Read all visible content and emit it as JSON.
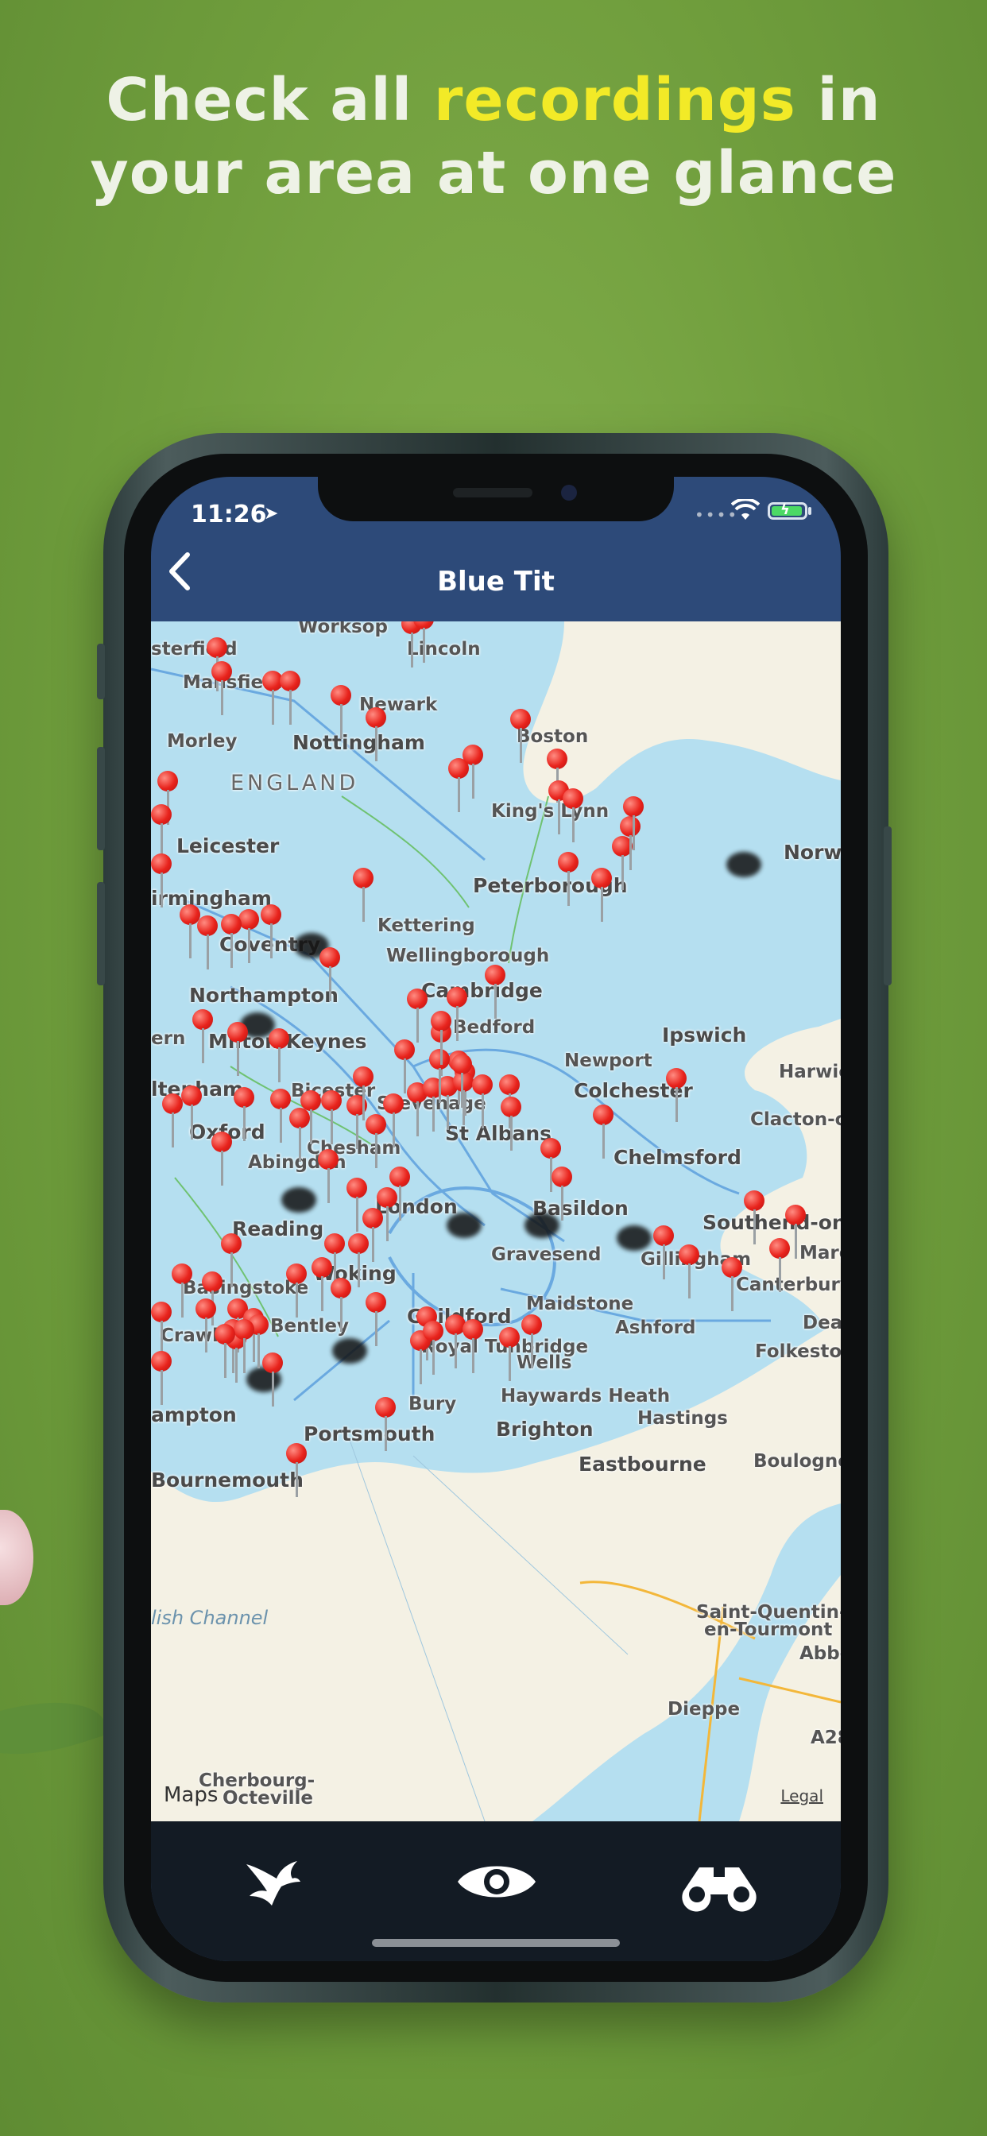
{
  "headline": {
    "line1_before": "Check all ",
    "line1_highlight": "recordings",
    "line1_after": " in",
    "line2": "your area at one glance"
  },
  "status_bar": {
    "time": "11:26"
  },
  "nav": {
    "title": "Blue Tit"
  },
  "map": {
    "places": [
      {
        "name": "Worksop",
        "cls": "place"
      },
      {
        "name": "Lincoln",
        "cls": "place"
      },
      {
        "name": "sterfield",
        "cls": "place"
      },
      {
        "name": "Mansfield",
        "cls": "place"
      },
      {
        "name": "Newark",
        "cls": "place"
      },
      {
        "name": "Boston",
        "cls": "place"
      },
      {
        "name": "Morley",
        "cls": "place"
      },
      {
        "name": "Nottingham",
        "cls": "place big"
      },
      {
        "name": "ENGLAND",
        "cls": "place region"
      },
      {
        "name": "King's Lynn",
        "cls": "place"
      },
      {
        "name": "Norwi",
        "cls": "place big"
      },
      {
        "name": "Leicester",
        "cls": "place big"
      },
      {
        "name": "Peterborough",
        "cls": "place big"
      },
      {
        "name": "irmingham",
        "cls": "place big"
      },
      {
        "name": "Kettering",
        "cls": "place"
      },
      {
        "name": "Coventry",
        "cls": "place big"
      },
      {
        "name": "Wellingborough",
        "cls": "place"
      },
      {
        "name": "Cambridge",
        "cls": "place big"
      },
      {
        "name": "Northampton",
        "cls": "place big"
      },
      {
        "name": "Bedford",
        "cls": "place"
      },
      {
        "name": "ern",
        "cls": "place"
      },
      {
        "name": "Milton Keynes",
        "cls": "place big"
      },
      {
        "name": "Ipswich",
        "cls": "place big"
      },
      {
        "name": "Newport",
        "cls": "place"
      },
      {
        "name": "Harwic",
        "cls": "place"
      },
      {
        "name": "ltenham",
        "cls": "place big"
      },
      {
        "name": "Bicester",
        "cls": "place"
      },
      {
        "name": "Stevenage",
        "cls": "place"
      },
      {
        "name": "Colchester",
        "cls": "place big"
      },
      {
        "name": "Clacton-on-",
        "cls": "place"
      },
      {
        "name": "Oxford",
        "cls": "place big"
      },
      {
        "name": "St Albans",
        "cls": "place big"
      },
      {
        "name": "Chelmsford",
        "cls": "place big"
      },
      {
        "name": "Abingdon",
        "cls": "place"
      },
      {
        "name": "Chesham",
        "cls": "place"
      },
      {
        "name": "London",
        "cls": "place big"
      },
      {
        "name": "Basildon",
        "cls": "place big"
      },
      {
        "name": "Southend-on-Se",
        "cls": "place big"
      },
      {
        "name": "Reading",
        "cls": "place big"
      },
      {
        "name": "Gravesend",
        "cls": "place"
      },
      {
        "name": "Gillingham",
        "cls": "place"
      },
      {
        "name": "Marg",
        "cls": "place"
      },
      {
        "name": "Basingstoke",
        "cls": "place"
      },
      {
        "name": "Woking",
        "cls": "place big"
      },
      {
        "name": "Canterbury",
        "cls": "place"
      },
      {
        "name": "Maidstone",
        "cls": "place"
      },
      {
        "name": "Bentley",
        "cls": "place"
      },
      {
        "name": "Guildford",
        "cls": "place big"
      },
      {
        "name": "Ashford",
        "cls": "place"
      },
      {
        "name": "Deal",
        "cls": "place"
      },
      {
        "name": "Crawl",
        "cls": "place"
      },
      {
        "name": "Royal Tunbridge",
        "cls": "place"
      },
      {
        "name": "Wells",
        "cls": "place"
      },
      {
        "name": "Folkestone",
        "cls": "place"
      },
      {
        "name": "Haywards Heath",
        "cls": "place"
      },
      {
        "name": "ampton",
        "cls": "place big"
      },
      {
        "name": "Bury",
        "cls": "place"
      },
      {
        "name": "Hastings",
        "cls": "place"
      },
      {
        "name": "Portsmouth",
        "cls": "place big"
      },
      {
        "name": "Brighton",
        "cls": "place big"
      },
      {
        "name": "Eastbourne",
        "cls": "place big"
      },
      {
        "name": "Boulogne",
        "cls": "place"
      },
      {
        "name": "Bournemouth",
        "cls": "place big"
      },
      {
        "name": "lish Channel",
        "cls": "place sea"
      },
      {
        "name": "Saint-Quentin-",
        "cls": "place"
      },
      {
        "name": "en-Tourmont",
        "cls": "place"
      },
      {
        "name": "Abbe",
        "cls": "place"
      },
      {
        "name": "Dieppe",
        "cls": "place"
      },
      {
        "name": "A28",
        "cls": "place"
      },
      {
        "name": "Cherbourg-",
        "cls": "place"
      },
      {
        "name": "Octeville",
        "cls": "place"
      }
    ],
    "credit": "Maps",
    "legal": "Legal",
    "recordings_count": 106
  },
  "tabs": [
    {
      "name": "bird-icon",
      "label": "Species"
    },
    {
      "name": "eye-icon",
      "label": "Observe"
    },
    {
      "name": "binoculars-icon",
      "label": "Binoculars"
    }
  ],
  "colors": {
    "nav_bar": "#2d4a79",
    "tab_bar": "#131b24",
    "pin": "#e8231c",
    "headline": "#eef2e6",
    "headline_highlight": "#f2ea27",
    "water": "#b5dff0",
    "land": "#f4f1e4"
  }
}
